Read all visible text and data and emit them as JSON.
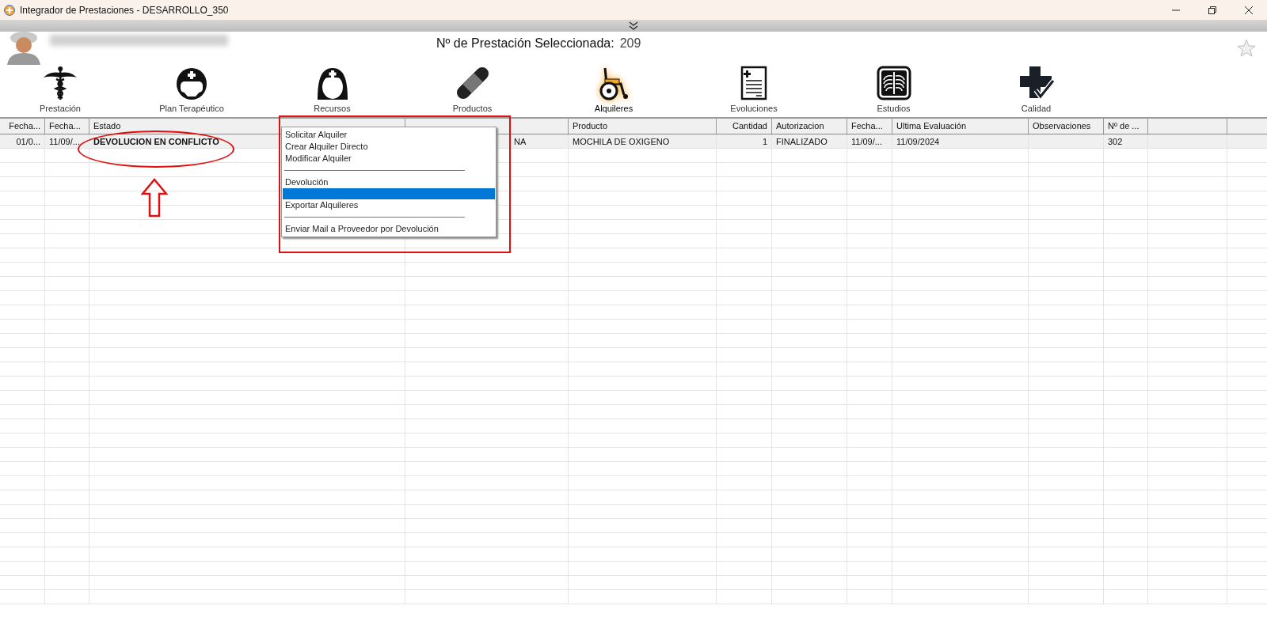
{
  "window": {
    "title": "Integrador de Prestaciones - DESARROLLO_350"
  },
  "header": {
    "label": "Nº de Prestación Seleccionada:",
    "value": "209"
  },
  "toolbar": [
    {
      "kind": "caduceus",
      "label": "Prestación",
      "selected": false
    },
    {
      "kind": "helmet",
      "label": "Plan Terapéutico",
      "selected": false
    },
    {
      "kind": "nurse",
      "label": "Recursos",
      "selected": false
    },
    {
      "kind": "bandage",
      "label": "Productos",
      "selected": false
    },
    {
      "kind": "wheelchair",
      "label": "Alquileres",
      "selected": true
    },
    {
      "kind": "document",
      "label": "Evoluciones",
      "selected": false
    },
    {
      "kind": "xray",
      "label": "Estudios",
      "selected": false
    },
    {
      "kind": "quality",
      "label": "Calidad",
      "selected": false
    }
  ],
  "table": {
    "columns": {
      "fecha_1": "Fecha...",
      "fecha_2": "Fecha...",
      "estado": "Estado",
      "producto": "Producto",
      "cantidad": "Cantidad",
      "autorizacion": "Autorizacion",
      "fecha_3": "Fecha...",
      "ultima_evaluacion": "Ultima Evaluación",
      "observaciones": "Observaciones",
      "numero": "Nº de ..."
    },
    "rows": [
      {
        "selected": true,
        "fecha_1": "01/0...",
        "fecha_2": "11/09/...",
        "estado": "DEVOLUCION EN CONFLICTO",
        "column_4": "NA",
        "producto": "MOCHILA DE OXIGENO",
        "cantidad": "1",
        "autorizacion": "FINALIZADO",
        "fecha_3": "11/09/...",
        "ultima_evaluacion": "11/09/2024",
        "numero": "302"
      }
    ]
  },
  "context_menu": [
    {
      "kind": "item",
      "label": "Solicitar Alquiler",
      "selected": false
    },
    {
      "kind": "item",
      "label": "Crear Alquiler Directo",
      "selected": false
    },
    {
      "kind": "item",
      "label": "Modificar Alquiler",
      "selected": false
    },
    {
      "kind": "separator"
    },
    {
      "kind": "item",
      "label": "Devolución",
      "selected": false
    },
    {
      "kind": "blank",
      "selected": true
    },
    {
      "kind": "item",
      "label": "Exportar Alquileres",
      "selected": false
    },
    {
      "kind": "separator"
    },
    {
      "kind": "item",
      "label": "Enviar Mail a Proveedor por Devolución",
      "selected": false
    }
  ]
}
